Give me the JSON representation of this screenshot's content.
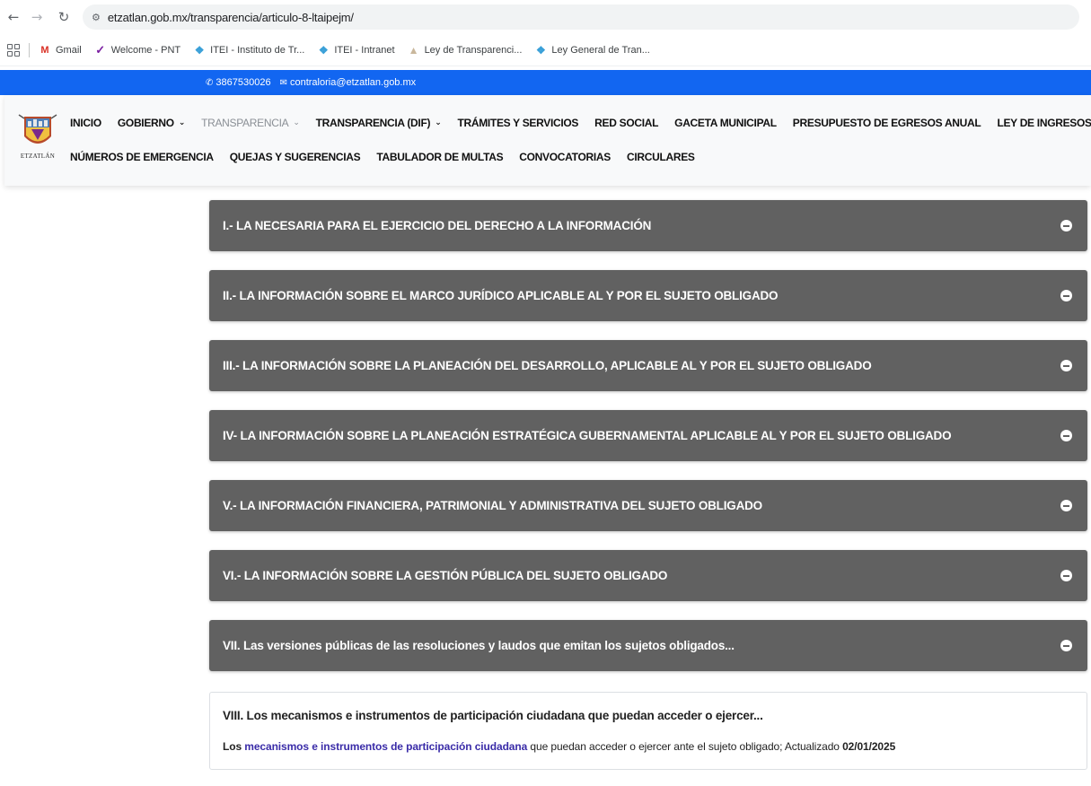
{
  "browser": {
    "url": "etzatlan.gob.mx/transparencia/articulo-8-ltaipejm/",
    "bookmarks": [
      {
        "label": "Gmail",
        "icon": "gmail-icon"
      },
      {
        "label": "Welcome - PNT",
        "icon": "pnt-icon"
      },
      {
        "label": "ITEI - Instituto de Tr...",
        "icon": "itei-icon"
      },
      {
        "label": "ITEI - Intranet",
        "icon": "itei-icon"
      },
      {
        "label": "Ley de Transparenci...",
        "icon": "ley-icon"
      },
      {
        "label": "Ley General de Tran...",
        "icon": "itei-icon"
      }
    ]
  },
  "infobar": {
    "phone": "3867530026",
    "email": "contraloria@etzatlan.gob.mx",
    "color": "#1266f1"
  },
  "logo": {
    "text": "ETZATLÁN"
  },
  "nav": {
    "row1": [
      {
        "label": "INICIO",
        "dropdown": false
      },
      {
        "label": "GOBIERNO",
        "dropdown": true
      },
      {
        "label": "TRANSPARENCIA",
        "dropdown": true,
        "active": true
      },
      {
        "label": "TRANSPARENCIA (DIF)",
        "dropdown": true
      },
      {
        "label": "TRÁMITES Y SERVICIOS",
        "dropdown": false
      },
      {
        "label": "RED SOCIAL",
        "dropdown": false
      },
      {
        "label": "GACETA MUNICIPAL",
        "dropdown": false
      },
      {
        "label": "PRESUPUESTO DE EGRESOS ANUAL",
        "dropdown": false
      },
      {
        "label": "LEY DE INGRESOS MUNICIPA",
        "dropdown": false
      }
    ],
    "row2": [
      {
        "label": "NÚMEROS DE EMERGENCIA"
      },
      {
        "label": "QUEJAS Y SUGERENCIAS"
      },
      {
        "label": "TABULADOR DE MULTAS"
      },
      {
        "label": "CONVOCATORIAS"
      },
      {
        "label": "CIRCULARES"
      }
    ]
  },
  "accordion": {
    "items": [
      {
        "title": "I.- LA NECESARIA PARA EL EJERCICIO DEL DERECHO A LA INFORMACIÓN"
      },
      {
        "title": "II.- LA INFORMACIÓN SOBRE EL MARCO JURÍDICO APLICABLE AL Y POR EL SUJETO OBLIGADO"
      },
      {
        "title": "III.- LA INFORMACIÓN SOBRE LA PLANEACIÓN DEL DESARROLLO, APLICABLE AL Y POR EL SUJETO OBLIGADO"
      },
      {
        "title": "IV- LA INFORMACIÓN SOBRE LA PLANEACIÓN ESTRATÉGICA GUBERNAMENTAL APLICABLE AL Y POR EL SUJETO OBLIGADO"
      },
      {
        "title": "V.- LA INFORMACIÓN FINANCIERA, PATRIMONIAL Y ADMINISTRATIVA DEL SUJETO OBLIGADO"
      },
      {
        "title": "VI.- LA INFORMACIÓN SOBRE LA GESTIÓN PÚBLICA DEL SUJETO OBLIGADO"
      },
      {
        "title": "VII. Las versiones públicas de las resoluciones y laudos que emitan los sujetos obligados..."
      }
    ],
    "open_item": {
      "title": "VIII. Los mecanismos e instrumentos de participación ciudadana que puedan acceder o ejercer...",
      "body_prefix": "Los",
      "body_link": "mecanismos e instrumentos de participación ciudadana",
      "body_suffix": "que puedan acceder o ejercer ante el sujeto obligado; Actualizado",
      "body_date": "02/01/2025"
    },
    "header_color": "#616161"
  }
}
